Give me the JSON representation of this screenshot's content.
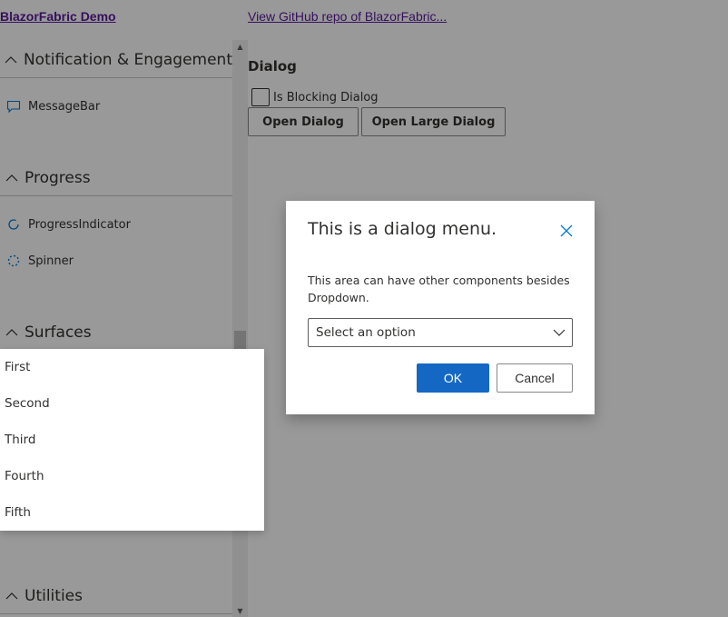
{
  "header": {
    "brand": "BlazorFabric Demo",
    "repo_link": "View GitHub repo of BlazorFabric..."
  },
  "sidebar": {
    "groups": [
      {
        "label": "Notification & Engagement",
        "items": [
          {
            "label": "MessageBar",
            "icon": "message-bar-icon"
          }
        ]
      },
      {
        "label": "Progress",
        "items": [
          {
            "label": "ProgressIndicator",
            "icon": "progress-ring-icon"
          },
          {
            "label": "Spinner",
            "icon": "spinner-icon"
          }
        ]
      },
      {
        "label": "Surfaces",
        "items": []
      },
      {
        "label": "Utilities",
        "items": []
      }
    ]
  },
  "main": {
    "title": "Dialog",
    "checkbox_label": "Is Blocking Dialog",
    "checkbox_checked": false,
    "open_dialog_label": "Open Dialog",
    "open_large_dialog_label": "Open Large Dialog"
  },
  "dialog": {
    "title": "This is a dialog menu.",
    "subtext": "This area can have other components besides Dropdown.",
    "dropdown_placeholder": "Select an option",
    "ok_label": "OK",
    "cancel_label": "Cancel"
  },
  "dropdown_options": [
    "First",
    "Second",
    "Third",
    "Fourth",
    "Fifth"
  ],
  "colors": {
    "primary": "#1468c4",
    "link": "#5a1a9e",
    "overlay": "rgba(0,0,0,0.40)"
  }
}
